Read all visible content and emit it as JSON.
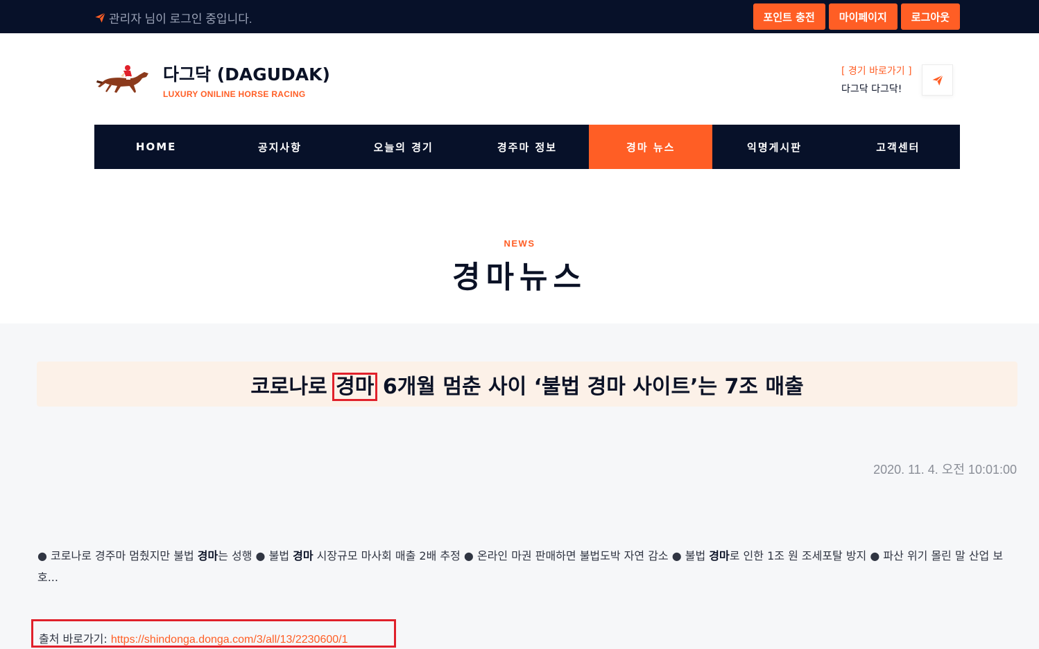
{
  "topbar": {
    "welcome": "관리자 님이 로그인 중입니다.",
    "buttons": [
      "포인트 충전",
      "마이페이지",
      "로그아웃"
    ]
  },
  "brand": {
    "title": "다그닥 (DAGUDAK)",
    "subtitle": "LUXURY ONILINE HORSE RACING"
  },
  "quick": {
    "label": "[ 경기 바로가기 ]",
    "text": "다그닥 다그닥!"
  },
  "nav": {
    "items": [
      "HOME",
      "공지사항",
      "오늘의 경기",
      "경주마 정보",
      "경마 뉴스",
      "익명게시판",
      "고객센터"
    ]
  },
  "page": {
    "subtitle": "NEWS",
    "title": "경마뉴스"
  },
  "article": {
    "title_pre": "코로나로 ",
    "title_highlight": "경마",
    "title_post": " 6개월 멈춘 사이 ‘불법 경마 사이트’는 7조 매출",
    "date": "2020. 11. 4. 오전 10:01:00",
    "summary_parts": [
      "● 코로나로 경주마 멈췄지만 불법 ",
      "경마",
      "는 성행 ● 불법 ",
      "경마",
      " 시장규모 마사회 매출 2배 추정 ● 온라인 마권 판매하면 불법도박 자연 감소 ● 불법 ",
      "경마",
      "로 인한 1조 원 조세포탈 방지 ● 파산 위기 몰린 말 산업 보호..."
    ],
    "source_label": "출처 바로가기: ",
    "source_url": "https://shindonga.donga.com/3/all/13/2230600/1"
  },
  "colors": {
    "accent": "#ff5e25",
    "dark": "#071129",
    "highlight_border": "#e0212b"
  },
  "icons": {
    "welcome": "paper-plane-icon",
    "quick": "paper-plane-icon",
    "logo": "horse-jockey-icon"
  }
}
